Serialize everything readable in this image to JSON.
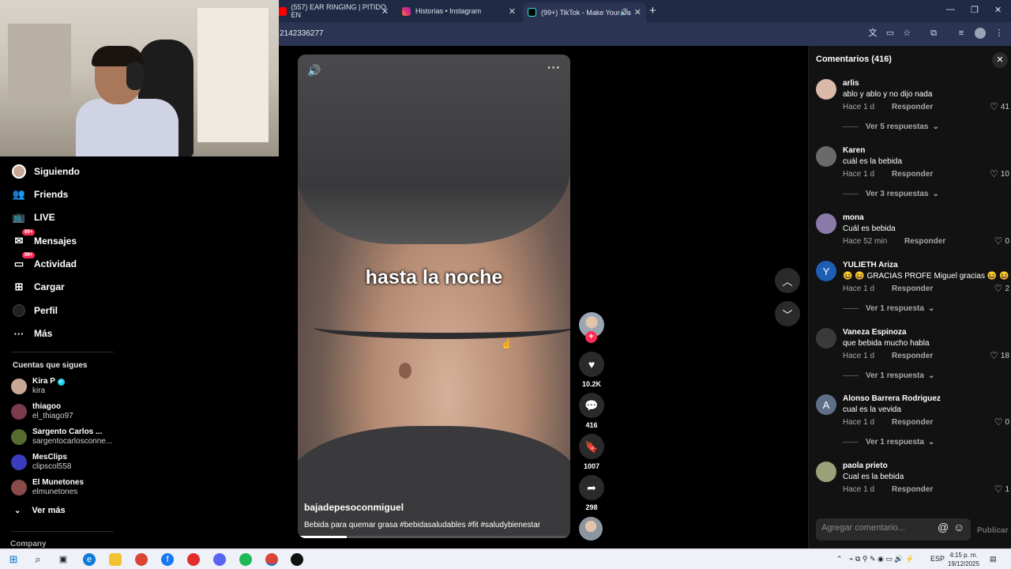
{
  "browser": {
    "tabs": [
      {
        "label": "(557) EAR RINGING | PITIDO EN",
        "color": "#ff0000",
        "active": false
      },
      {
        "label": "Historias • Instagram",
        "color": "#e1306c",
        "active": false
      },
      {
        "label": "(99+) TikTok - Make Your Da",
        "color": "#111111",
        "active": true
      }
    ],
    "new_tab": "+",
    "url": "2142336277",
    "window_controls": {
      "minimize": "—",
      "restore": "❐",
      "close": "✕"
    }
  },
  "sidebar": {
    "items": [
      {
        "label": "Siguiendo",
        "icon": "avatar-icon"
      },
      {
        "label": "Friends",
        "icon": "friends-icon"
      },
      {
        "label": "LIVE",
        "icon": "live-icon"
      },
      {
        "label": "Mensajes",
        "icon": "messages-icon",
        "badge": "99+"
      },
      {
        "label": "Actividad",
        "icon": "activity-icon",
        "badge": "99+"
      },
      {
        "label": "Cargar",
        "icon": "upload-icon"
      },
      {
        "label": "Perfil",
        "icon": "profile-icon"
      },
      {
        "label": "Más",
        "icon": "more-icon"
      }
    ],
    "following_heading": "Cuentas que sigues",
    "following": [
      {
        "name": "Kira P",
        "user": "kira",
        "verified": true,
        "color": "#c9a896"
      },
      {
        "name": "thiagoo",
        "user": "el_thiago97",
        "verified": false,
        "color": "#7a3b4a"
      },
      {
        "name": "Sargento Carlos ...",
        "user": "sargentocarlosconne...",
        "verified": false,
        "color": "#556b2f"
      },
      {
        "name": "MesClips",
        "user": "clipscol558",
        "verified": false,
        "color": "#3b3bbf"
      },
      {
        "name": "El Munetones",
        "user": "elmunetones",
        "verified": false,
        "color": "#8a4a4a"
      }
    ],
    "see_more": "Ver más",
    "company": "Company"
  },
  "video": {
    "overlay_text": "hasta la noche",
    "author": "bajadepesoconmiguel",
    "description": "Bebida para quemar grasa #bebidasaludables #fit #saludybienestar",
    "progress": 0.18
  },
  "actions": {
    "likes": "10.2K",
    "comments": "416",
    "saves": "1007",
    "shares": "298"
  },
  "comments_panel": {
    "title": "Comentarios (416)",
    "reply_label": "Responder",
    "comments": [
      {
        "user": "arlis",
        "text": "ablo y ablo y no dijo nada",
        "time": "Hace 1 d",
        "likes": "41",
        "more": "Ver 5 respuestas",
        "avatar_color": "#d9b9a7",
        "initial": ""
      },
      {
        "user": "Karen",
        "text": "cuál es la bebida",
        "time": "Hace 1 d",
        "likes": "10",
        "more": "Ver 3 respuestas",
        "avatar_color": "#6a6a6a",
        "initial": ""
      },
      {
        "user": "mona",
        "text": "Cuál es bebida",
        "time": "Hace 52 min",
        "likes": "0",
        "more": "",
        "avatar_color": "#8a7aa8",
        "initial": ""
      },
      {
        "user": "YULIETH Ariza",
        "text": "😆 😆 GRACIAS PROFE Miguel gracias 😆 😆",
        "time": "Hace 1 d",
        "likes": "2",
        "more": "Ver 1 respuesta",
        "avatar_color": "#1d5fb3",
        "initial": "Y"
      },
      {
        "user": "Vaneza Espinoza",
        "text": "que bebida mucho habla",
        "time": "Hace 1 d",
        "likes": "18",
        "more": "Ver 1 respuesta",
        "avatar_color": "#3a3a3a",
        "initial": ""
      },
      {
        "user": "Alonso Barrera Rodriguez",
        "text": "cual es la vevida",
        "time": "Hace 1 d",
        "likes": "0",
        "more": "Ver 1 respuesta",
        "avatar_color": "#5f6f87",
        "initial": "A"
      },
      {
        "user": "paola prieto",
        "text": "Cual es la bebida",
        "time": "Hace 1 d",
        "likes": "1",
        "more": "",
        "avatar_color": "#9aa07a",
        "initial": ""
      }
    ],
    "input_placeholder": "Agregar comentario...",
    "publish": "Publicar"
  },
  "taskbar": {
    "language": "ESP",
    "time": "4:15 p. m.",
    "date": "19/12/2025"
  }
}
